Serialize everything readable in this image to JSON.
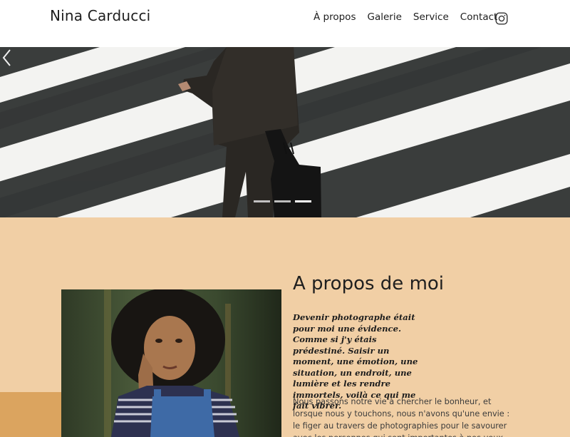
{
  "header": {
    "brand": "Nina Carducci",
    "nav": [
      "À propos",
      "Galerie",
      "Service",
      "Contact"
    ],
    "social_icon": "instagram-icon"
  },
  "hero": {
    "prev_icon": "chevron-left-icon",
    "indicators": 3,
    "active_indicator": 3
  },
  "about": {
    "title": "A propos de moi",
    "quote": "Devenir photographe était pour moi une évidence. Comme si j'y étais prédestiné. Saisir un moment, une émotion, une situation, un endroit, une lumière et les rendre immortels, voilà ce qui me fait vibrer.",
    "text": "Nous passons notre vie à chercher le bonheur, et lorsque nous y touchons, nous n'avons qu'une envie : le figer au travers de photographies pour le savourer avec les personnes qui sont importantes à nos yeux, ou le"
  },
  "colors": {
    "about_bg": "#f1cfa5",
    "accent": "#dba45f"
  }
}
